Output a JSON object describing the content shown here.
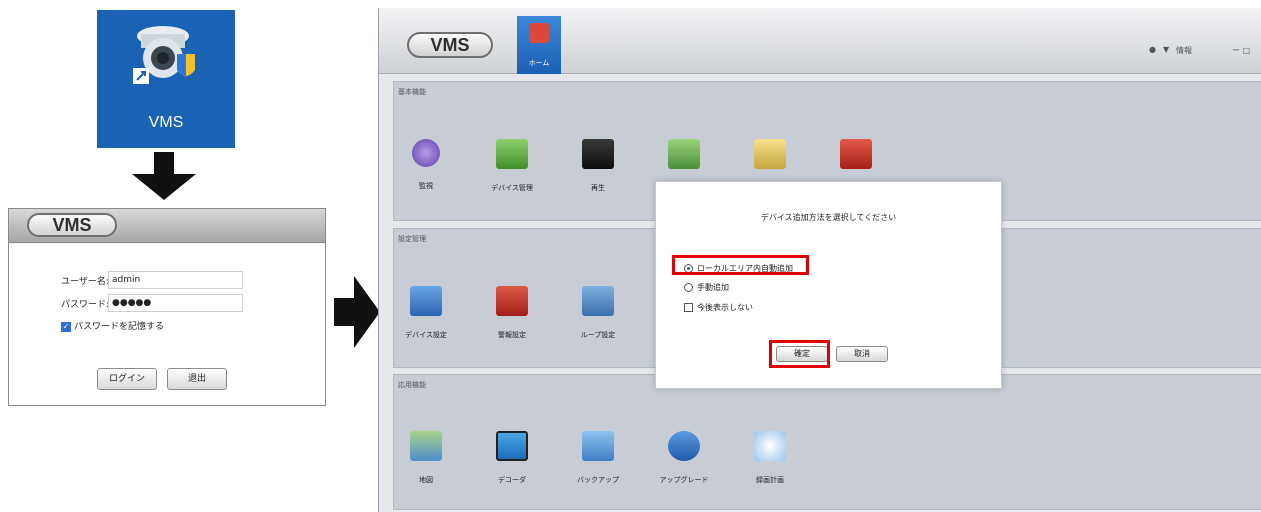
{
  "desktop": {
    "shortcut_label": "VMS"
  },
  "login": {
    "logo": "VMS",
    "username_label": "ユーザー名:",
    "username_value": "admin",
    "password_label": "パスワード:",
    "password_value": "●●●●●",
    "remember_label": "パスワードを記憶する",
    "login_button": "ログイン",
    "exit_button": "退出"
  },
  "main": {
    "logo": "VMS",
    "home_tab": "ホーム",
    "window_controls": "ー □",
    "info_label": "情報",
    "sections": [
      {
        "title": "基本機能",
        "items": [
          "監視",
          "デバイス管理",
          "再生",
          "",
          "",
          ""
        ]
      },
      {
        "title": "設定管理",
        "items": [
          "デバイス設定",
          "警報設定",
          "ループ設定"
        ]
      },
      {
        "title": "応用機能",
        "items": [
          "地図",
          "デコーダ",
          "バックアップ",
          "アップグレード",
          "録画計画"
        ]
      }
    ],
    "colors": {
      "accent": "#1b5fb3",
      "highlight": "#e00000",
      "panel": "#c7ccd5"
    }
  },
  "dialog": {
    "question": "デバイス追加方法を選択してください",
    "option_auto": "ローカルエリア内自動追加",
    "option_manual": "手動追加",
    "option_hide": "今後表示しない",
    "ok_button": "確定",
    "cancel_button": "取消"
  }
}
